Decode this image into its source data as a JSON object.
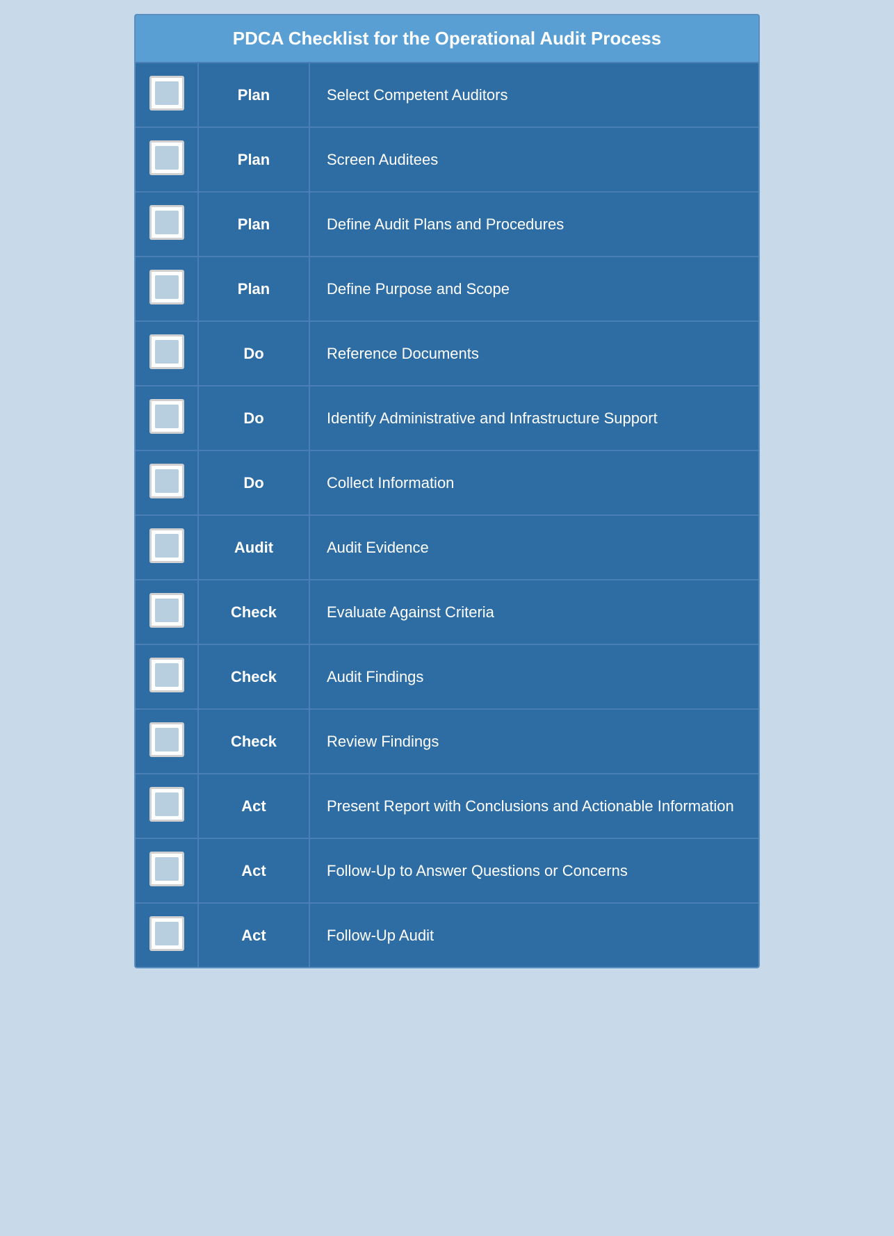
{
  "title": "PDCA Checklist for the Operational Audit Process",
  "rows": [
    {
      "phase": "Plan",
      "description": "Select Competent Auditors"
    },
    {
      "phase": "Plan",
      "description": "Screen Auditees"
    },
    {
      "phase": "Plan",
      "description": "Define Audit Plans and Procedures"
    },
    {
      "phase": "Plan",
      "description": "Define Purpose and Scope"
    },
    {
      "phase": "Do",
      "description": "Reference Documents"
    },
    {
      "phase": "Do",
      "description": "Identify Administrative and Infrastructure Support"
    },
    {
      "phase": "Do",
      "description": "Collect Information"
    },
    {
      "phase": "Audit",
      "description": "Audit Evidence"
    },
    {
      "phase": "Check",
      "description": "Evaluate Against Criteria"
    },
    {
      "phase": "Check",
      "description": "Audit Findings"
    },
    {
      "phase": "Check",
      "description": "Review Findings"
    },
    {
      "phase": "Act",
      "description": "Present Report with Conclusions and Actionable Information"
    },
    {
      "phase": "Act",
      "description": "Follow-Up to Answer Questions or Concerns"
    },
    {
      "phase": "Act",
      "description": "Follow-Up Audit"
    }
  ]
}
